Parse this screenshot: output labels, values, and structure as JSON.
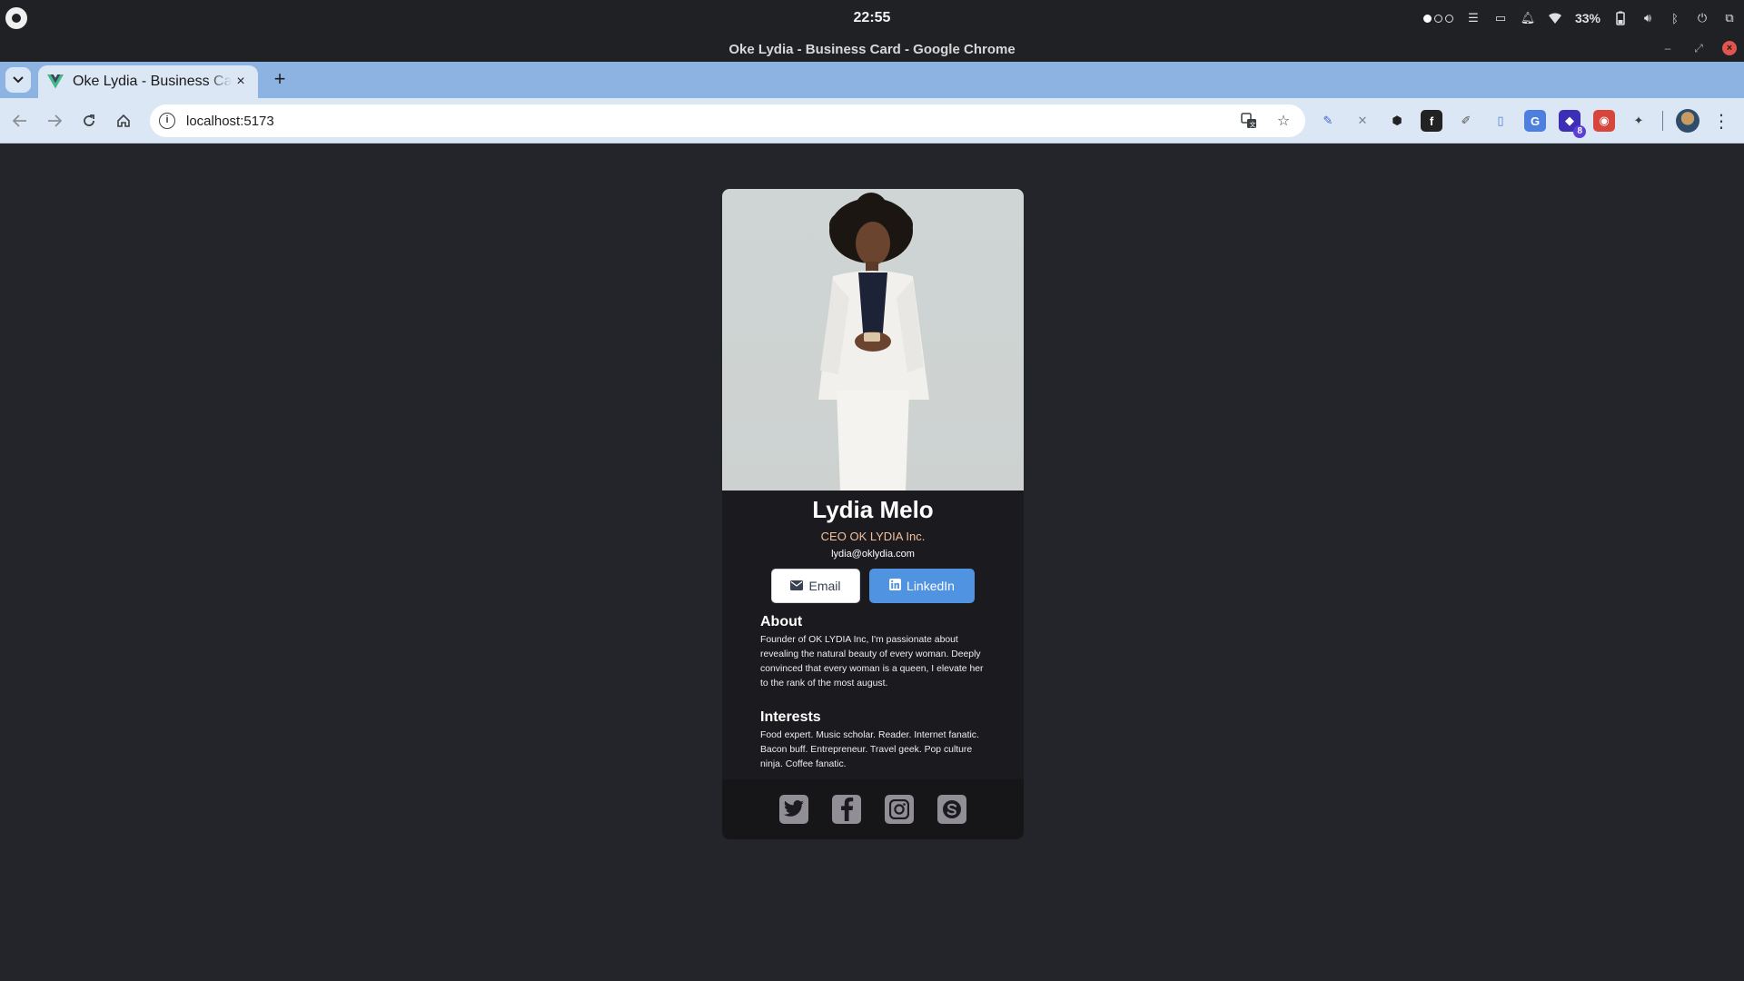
{
  "os": {
    "clock": "22:55",
    "battery": "33%"
  },
  "window": {
    "title": "Oke Lydia - Business Card - Google Chrome"
  },
  "tab": {
    "title": "Oke Lydia - Business Card",
    "close": "×",
    "new_tab": "+"
  },
  "toolbar": {
    "url": "localhost:5173",
    "extension_badge": "8"
  },
  "card": {
    "name": "Lydia Melo",
    "title": "CEO OK LYDIA Inc.",
    "email": "lydia@oklydia.com",
    "buttons": {
      "email": "Email",
      "linkedin": "LinkedIn"
    },
    "about": {
      "heading": "About",
      "text": "Founder of OK LYDIA Inc, I'm passionate about revealing the natural beauty of every woman. Deeply convinced that every woman is a queen, I elevate her to the rank of the most august."
    },
    "interests": {
      "heading": "Interests",
      "text": "Food expert. Music scholar. Reader. Internet fanatic. Bacon buff. Entrepreneur. Travel geek. Pop culture ninja. Coffee fanatic."
    },
    "social_icons": [
      "twitter-icon",
      "facebook-icon",
      "instagram-icon",
      "skype-icon"
    ]
  },
  "colors": {
    "page_bg": "#24252a",
    "card_bg": "#1b1b1f",
    "accent_title": "#f3bf99",
    "linkedin_blue": "#5093e1",
    "tab_strip": "#8db3e2"
  }
}
